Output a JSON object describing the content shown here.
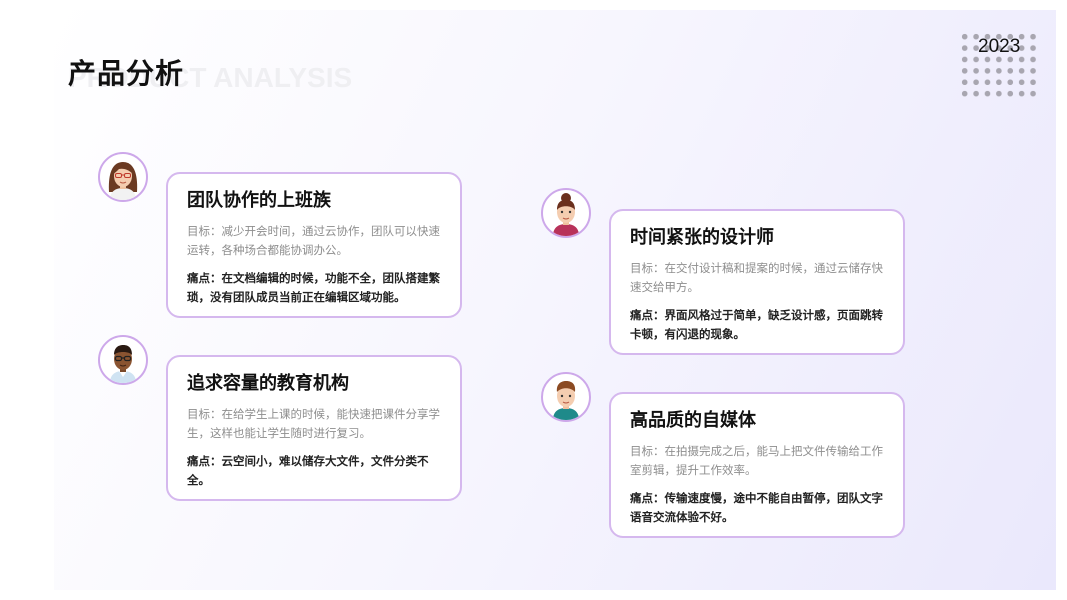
{
  "header": {
    "title": "产品分析",
    "title_watermark": "PRODUCT ANALYSIS",
    "year": "2023"
  },
  "colors": {
    "card_border": "#d5b8ee",
    "avatar_border": "#cda8ea",
    "dots": "#a8a6b0"
  },
  "personas": [
    {
      "title": "团队协作的上班族",
      "goal": "目标：减少开会时间，通过云协作，团队可以快速运转，各种场合都能协调办公。",
      "pain": "痛点：在文档编辑的时候，功能不全，团队搭建繁琐，没有团队成员当前正在编辑区域功能。",
      "avatar_icon": "woman-glasses-avatar-icon"
    },
    {
      "title": "追求容量的教育机构",
      "goal": "目标：在给学生上课的时候，能快速把课件分享学生，这样也能让学生随时进行复习。",
      "pain": "痛点：云空间小，难以储存大文件，文件分类不全。",
      "avatar_icon": "man-glasses-avatar-icon"
    },
    {
      "title": "时间紧张的设计师",
      "goal": "目标：在交付设计稿和提案的时候，通过云储存快速交给甲方。",
      "pain": "痛点：界面风格过于简单，缺乏设计感，页面跳转卡顿，有闪退的现象。",
      "avatar_icon": "woman-bun-avatar-icon"
    },
    {
      "title": "高品质的自媒体",
      "goal": "目标：在拍摄完成之后，能马上把文件传输给工作室剪辑，提升工作效率。",
      "pain": "痛点：传输速度慢，途中不能自由暂停，团队文字语音交流体验不好。",
      "avatar_icon": "man-avatar-icon"
    }
  ]
}
